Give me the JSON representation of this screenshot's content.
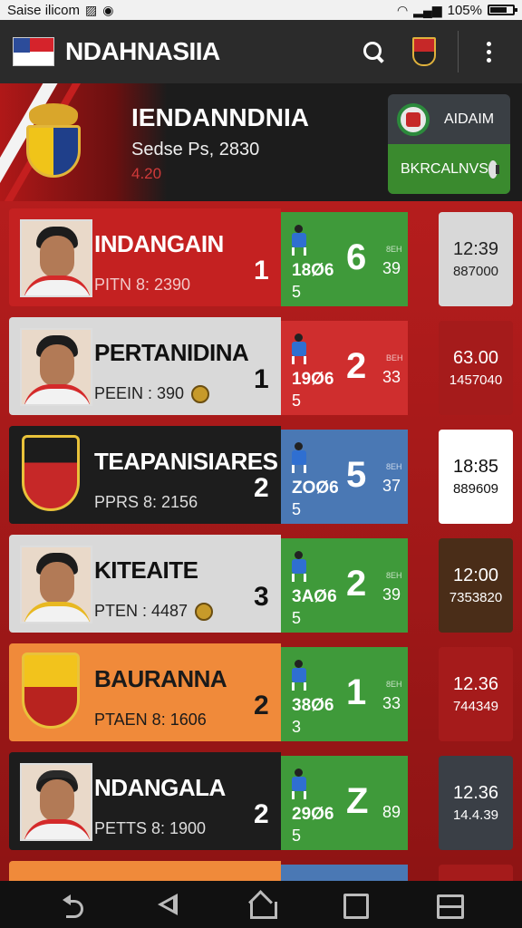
{
  "status_bar": {
    "carrier": "Saise ilicom",
    "battery": "105%"
  },
  "app_bar": {
    "title": "NDAHNASIIA"
  },
  "hero": {
    "title": "IENDANNDNIA",
    "subtitle": "Sedse Ps, 2830",
    "number": "4.20",
    "card_top_label": "AIDAIM",
    "card_bottom_label": "BKRCALNVS"
  },
  "cards": [
    {
      "name": "INDANGAIN",
      "sub": "PITN 8: 2390",
      "rank": "1",
      "year": "18Ø6",
      "yearsub": "5",
      "score": "6",
      "tiny": "8EH",
      "pts": "39",
      "time": "12:39",
      "time_sub": "887000",
      "colors": {
        "main": "#c42121",
        "main_text": "#ffffff",
        "sub_text": "#f2c9c9",
        "score_bg": "#3f9a3a",
        "time_bg": "#d8d8d8",
        "time_text": "#222222",
        "shirt": "#d42a2a"
      },
      "avatar": "player"
    },
    {
      "name": "PERTANIDINA",
      "sub": "PEEIN : 390",
      "rank": "1",
      "year": "19Ø6",
      "yearsub": "5",
      "score": "2",
      "tiny": "BEH",
      "pts": "33",
      "time": "63.00",
      "time_sub": "1457040",
      "colors": {
        "main": "#d9d9d9",
        "main_text": "#111111",
        "sub_text": "#222222",
        "score_bg": "#cf2e2e",
        "time_bg": "#a51b1b",
        "time_text": "#ffffff",
        "shirt": "#d42a2a"
      },
      "avatar": "player",
      "coin": true
    },
    {
      "name": "TEAPANISIARES",
      "sub": "PPRS 8: 2156",
      "rank": "2",
      "year": "ZOØ6",
      "yearsub": "5",
      "score": "5",
      "tiny": "8EH",
      "pts": "37",
      "time": "18:85",
      "time_sub": "889609",
      "colors": {
        "main": "#1d1d1d",
        "main_text": "#ffffff",
        "sub_text": "#dddddd",
        "score_bg": "#4a78b4",
        "time_bg": "#ffffff",
        "time_text": "#111111",
        "shirt": "#d42a2a"
      },
      "avatar": "crest-red"
    },
    {
      "name": "KITEAITE",
      "sub": "PTEN : 4487",
      "rank": "3",
      "year": "3AØ6",
      "yearsub": "5",
      "score": "2",
      "tiny": "8EH",
      "pts": "39",
      "time": "12:00",
      "time_sub": "7353820",
      "colors": {
        "main": "#d9d9d9",
        "main_text": "#111111",
        "sub_text": "#222222",
        "score_bg": "#3f9a3a",
        "time_bg": "#4a2d18",
        "time_text": "#ffffff",
        "shirt": "#e8b821"
      },
      "avatar": "player",
      "coin": true
    },
    {
      "name": "BAURANNA",
      "sub": "PTAEN 8: 1606",
      "rank": "2",
      "year": "38Ø6",
      "yearsub": "3",
      "score": "1",
      "tiny": "8EH",
      "pts": "33",
      "time": "12.36",
      "time_sub": "744349",
      "colors": {
        "main": "#f08a3a",
        "main_text": "#1a1a1a",
        "sub_text": "#1a1a1a",
        "score_bg": "#3f9a3a",
        "time_bg": "#a51b1b",
        "time_text": "#ffffff",
        "shirt": "#d42a2a"
      },
      "avatar": "crest-orange"
    },
    {
      "name": "NDANGALA",
      "sub": "PETTS 8: 1900",
      "rank": "2",
      "year": "29Ø6",
      "yearsub": "5",
      "score": "Z",
      "tiny": "",
      "pts": "89",
      "time": "12.36",
      "time_sub": "14.4.39",
      "colors": {
        "main": "#1d1d1d",
        "main_text": "#ffffff",
        "sub_text": "#dddddd",
        "score_bg": "#3f9a3a",
        "time_bg": "#3a3f46",
        "time_text": "#ffffff",
        "shirt": "#d42a2a"
      },
      "avatar": "player-cap"
    }
  ]
}
